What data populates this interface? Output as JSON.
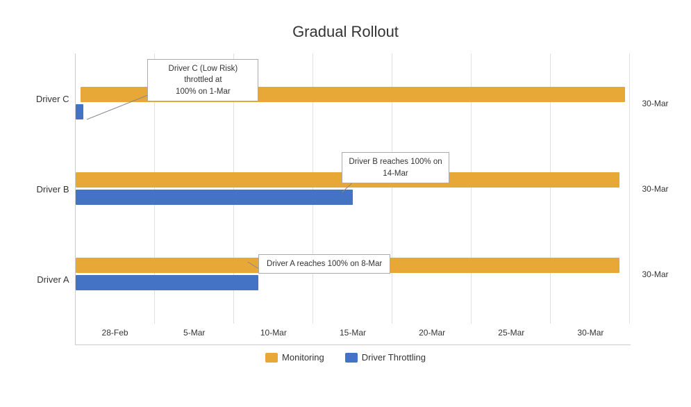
{
  "title": "Gradual Rollout",
  "yLabels": [
    "Driver C",
    "Driver B",
    "Driver A"
  ],
  "xLabels": [
    "28-Feb",
    "5-Mar",
    "10-Mar",
    "15-Mar",
    "20-Mar",
    "25-Mar",
    "30-Mar"
  ],
  "rightLabels": [
    "30-Mar",
    "30-Mar",
    "30-Mar"
  ],
  "bars": [
    {
      "driver": "Driver C",
      "orange": {
        "left": 0.008,
        "width": 0.982
      },
      "blue": {
        "left": 0.0,
        "width": 0.012
      }
    },
    {
      "driver": "Driver B",
      "orange": {
        "left": 0.0,
        "width": 0.982
      },
      "blue": {
        "left": 0.0,
        "width": 0.48
      }
    },
    {
      "driver": "Driver A",
      "orange": {
        "left": 0.0,
        "width": 0.982
      },
      "blue": {
        "left": 0.0,
        "width": 0.33
      }
    }
  ],
  "annotations": [
    {
      "id": "ann-c",
      "text": "Driver C (Low Risk) throttled at\n100% on 1-Mar",
      "boxLeft": "16%",
      "boxTop": "0%"
    },
    {
      "id": "ann-b",
      "text": "Driver B reaches 100% on\n14-Mar",
      "boxLeft": "50%",
      "boxTop": "32%"
    },
    {
      "id": "ann-a",
      "text": "Driver A reaches 100% on 8-Mar",
      "boxLeft": "36%",
      "boxTop": "67%"
    }
  ],
  "legend": [
    {
      "id": "monitoring",
      "label": "Monitoring",
      "color": "#E8A838"
    },
    {
      "id": "driver-throttling",
      "label": "Driver Throttling",
      "color": "#4472C4"
    }
  ]
}
